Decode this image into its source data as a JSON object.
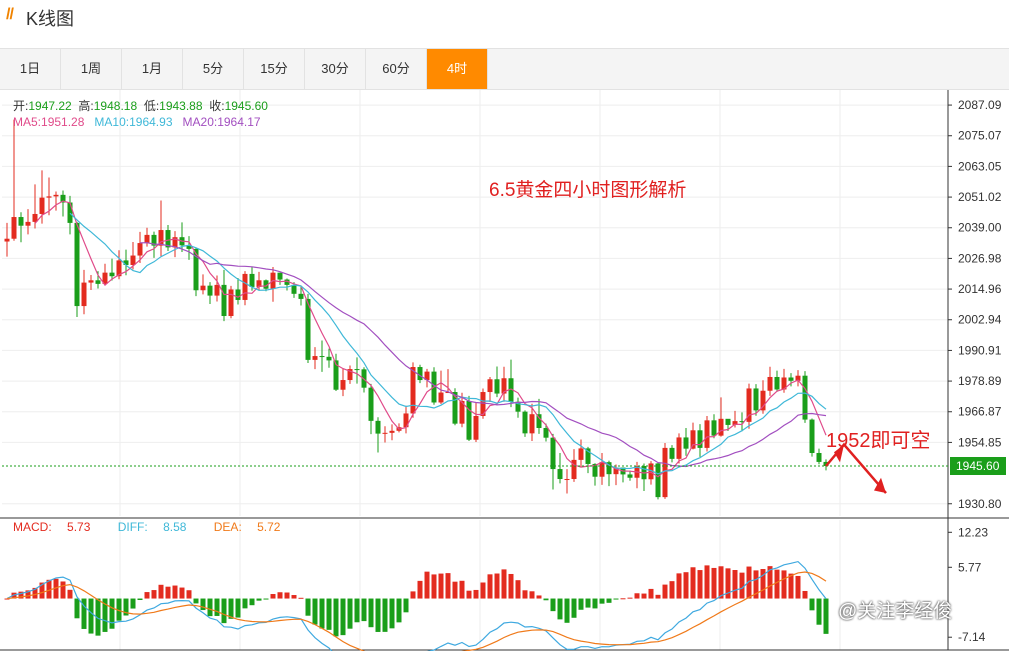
{
  "app": {
    "title": "K线图"
  },
  "tabs": [
    {
      "label": "1日",
      "active": false
    },
    {
      "label": "1周",
      "active": false
    },
    {
      "label": "1月",
      "active": false
    },
    {
      "label": "5分",
      "active": false
    },
    {
      "label": "15分",
      "active": false
    },
    {
      "label": "30分",
      "active": false
    },
    {
      "label": "60分",
      "active": false
    },
    {
      "label": "4时",
      "active": true
    }
  ],
  "ohlc": {
    "open_label": "开:",
    "open": "1947.22",
    "high_label": "高:",
    "high": "1948.18",
    "low_label": "低:",
    "low": "1943.88",
    "close_label": "收:",
    "close": "1945.60"
  },
  "ma": {
    "ma5_label": "MA5:",
    "ma5": "1951.28",
    "ma10_label": "MA10:",
    "ma10": "1964.93",
    "ma20_label": "MA20:",
    "ma20": "1964.17"
  },
  "macd_legend": {
    "macd_label": "MACD:",
    "macd": "5.73",
    "diff_label": "DIFF:",
    "diff": "8.58",
    "dea_label": "DEA:",
    "dea": "5.72"
  },
  "annotations": {
    "title": "6.5黄金四小时图形解析",
    "target": "1952即可空"
  },
  "watermark": "@关注李经俊",
  "colors": {
    "up": "#e32b1f",
    "down": "#1a9e1a",
    "ma5": "#e04b8a",
    "ma10": "#3fb8d8",
    "ma20": "#a24fc0",
    "diff": "#3fa9e0",
    "dea": "#f07a1a",
    "last_price_bg": "#1a9e1a",
    "accent": "#ff8a00"
  },
  "chart_data": {
    "type": "candlestick",
    "price_axis": {
      "ticks": [
        "2087.09",
        "2075.07",
        "2063.05",
        "2051.02",
        "2039.00",
        "2026.98",
        "2014.96",
        "2002.94",
        "1990.91",
        "1978.89",
        "1966.87",
        "1954.85",
        "1930.80"
      ],
      "last_price": "1945.60",
      "range": [
        1926.0,
        2093.0
      ]
    },
    "macd_axis": {
      "ticks": [
        "12.23",
        "5.77",
        "-7.14"
      ],
      "range": [
        -9.5,
        14.5
      ]
    },
    "candles": [
      [
        2033.6,
        2034.7,
        2027.7,
        2040.9
      ],
      [
        2034.7,
        2043.2,
        2033.9,
        2081.4
      ],
      [
        2043.2,
        2039.8,
        2033.3,
        2045.1
      ],
      [
        2039.8,
        2041.3,
        2036.4,
        2046.3
      ],
      [
        2041.3,
        2044.4,
        2038.7,
        2056.0
      ],
      [
        2044.4,
        2050.8,
        2040.6,
        2061.5
      ],
      [
        2050.8,
        2051.3,
        2043.9,
        2058.7
      ],
      [
        2051.3,
        2051.9,
        2045.7,
        2053.2
      ],
      [
        2051.9,
        2048.9,
        2043.4,
        2053.6
      ],
      [
        2048.9,
        2040.9,
        2036.4,
        2051.5
      ],
      [
        2040.9,
        2008.3,
        2004.0,
        2041.3
      ],
      [
        2008.3,
        2017.5,
        2005.1,
        2022.5
      ],
      [
        2017.5,
        2018.4,
        2014.6,
        2020.5
      ],
      [
        2018.4,
        2017.0,
        2015.2,
        2022.0
      ],
      [
        2017.0,
        2021.4,
        2016.3,
        2024.9
      ],
      [
        2021.4,
        2020.0,
        2018.3,
        2026.9
      ],
      [
        2020.0,
        2026.2,
        2018.8,
        2030.2
      ],
      [
        2026.2,
        2024.4,
        2020.4,
        2030.4
      ],
      [
        2024.4,
        2028.1,
        2022.7,
        2033.4
      ],
      [
        2028.1,
        2033.0,
        2025.2,
        2037.4
      ],
      [
        2033.0,
        2036.2,
        2031.6,
        2039.0
      ],
      [
        2036.2,
        2032.0,
        2027.2,
        2037.5
      ],
      [
        2032.0,
        2038.1,
        2027.8,
        2049.7
      ],
      [
        2038.1,
        2031.3,
        2029.9,
        2040.1
      ],
      [
        2031.3,
        2035.3,
        2027.5,
        2037.7
      ],
      [
        2035.3,
        2032.1,
        2029.5,
        2041.1
      ],
      [
        2032.1,
        2030.7,
        2026.4,
        2035.7
      ],
      [
        2030.7,
        2014.5,
        2012.2,
        2031.0
      ],
      [
        2014.5,
        2016.3,
        2012.9,
        2020.7
      ],
      [
        2016.3,
        2012.4,
        2009.1,
        2017.7
      ],
      [
        2012.4,
        2016.6,
        2010.1,
        2020.3
      ],
      [
        2016.6,
        2004.4,
        2002.4,
        2022.5
      ],
      [
        2004.4,
        2014.8,
        2003.5,
        2016.2
      ],
      [
        2014.8,
        2010.7,
        2008.9,
        2019.3
      ],
      [
        2010.7,
        2020.9,
        2008.6,
        2022.0
      ],
      [
        2020.9,
        2015.8,
        2014.3,
        2023.6
      ],
      [
        2015.8,
        2018.4,
        2014.3,
        2021.7
      ],
      [
        2018.4,
        2015.1,
        2014.1,
        2018.7
      ],
      [
        2015.1,
        2021.4,
        2010.0,
        2023.6
      ],
      [
        2021.4,
        2018.7,
        2016.6,
        2020.5
      ],
      [
        2018.7,
        2016.6,
        2014.4,
        2019.1
      ],
      [
        2016.6,
        2013.1,
        2011.5,
        2017.7
      ],
      [
        2013.1,
        2011.1,
        2008.5,
        2016.2
      ],
      [
        2011.1,
        1987.2,
        1986.0,
        2013.1
      ],
      [
        1987.2,
        1988.7,
        1983.6,
        1992.2
      ],
      [
        1988.7,
        1988.4,
        1982.5,
        1994.8
      ],
      [
        1988.4,
        1987.0,
        1984.1,
        1991.6
      ],
      [
        1987.0,
        1975.5,
        1975.0,
        1989.6
      ],
      [
        1975.5,
        1979.3,
        1973.0,
        1983.8
      ],
      [
        1979.3,
        1983.6,
        1977.8,
        1985.0
      ],
      [
        1983.6,
        1983.5,
        1977.9,
        1988.2
      ],
      [
        1983.5,
        1976.3,
        1974.4,
        1984.3
      ],
      [
        1976.3,
        1963.3,
        1958.1,
        1977.8
      ],
      [
        1963.3,
        1958.3,
        1950.9,
        1964.7
      ],
      [
        1958.3,
        1958.6,
        1954.8,
        1961.2
      ],
      [
        1958.6,
        1959.4,
        1955.7,
        1961.9
      ],
      [
        1959.4,
        1960.8,
        1958.8,
        1962.3
      ],
      [
        1960.8,
        1966.2,
        1958.4,
        1969.2
      ],
      [
        1966.2,
        1984.4,
        1964.5,
        1986.2
      ],
      [
        1984.4,
        1979.3,
        1978.1,
        1985.3
      ],
      [
        1979.3,
        1982.6,
        1976.4,
        1983.7
      ],
      [
        1982.6,
        1970.5,
        1969.6,
        1984.3
      ],
      [
        1970.5,
        1974.4,
        1969.9,
        1983.0
      ],
      [
        1974.4,
        1974.6,
        1974.2,
        1983.6
      ],
      [
        1974.6,
        1962.2,
        1961.6,
        1976.1
      ],
      [
        1962.2,
        1971.1,
        1960.8,
        1974.3
      ],
      [
        1971.1,
        1955.9,
        1955.4,
        1973.1
      ],
      [
        1955.9,
        1965.2,
        1955.0,
        1970.7
      ],
      [
        1965.2,
        1974.6,
        1964.1,
        1976.0
      ],
      [
        1974.6,
        1979.6,
        1970.7,
        1980.5
      ],
      [
        1979.6,
        1974.0,
        1972.6,
        1984.6
      ],
      [
        1974.0,
        1980.0,
        1970.8,
        1984.5
      ],
      [
        1980.0,
        1970.8,
        1968.7,
        1987.3
      ],
      [
        1970.8,
        1966.9,
        1964.5,
        1972.4
      ],
      [
        1966.9,
        1958.4,
        1957.0,
        1967.4
      ],
      [
        1958.4,
        1965.9,
        1955.4,
        1970.0
      ],
      [
        1965.9,
        1960.5,
        1958.2,
        1971.9
      ],
      [
        1960.5,
        1956.7,
        1955.2,
        1962.2
      ],
      [
        1956.7,
        1944.4,
        1936.4,
        1958.2
      ],
      [
        1944.4,
        1940.5,
        1938.8,
        1950.7
      ],
      [
        1940.5,
        1940.5,
        1934.8,
        1944.4
      ],
      [
        1940.5,
        1948.0,
        1939.4,
        1952.2
      ],
      [
        1948.0,
        1952.5,
        1945.2,
        1956.0
      ],
      [
        1952.5,
        1946.4,
        1942.8,
        1953.1
      ],
      [
        1946.4,
        1941.4,
        1937.9,
        1946.7
      ],
      [
        1941.4,
        1947.1,
        1938.2,
        1950.7
      ],
      [
        1947.1,
        1942.4,
        1937.7,
        1947.7
      ],
      [
        1942.4,
        1945.0,
        1938.1,
        1946.2
      ],
      [
        1945.0,
        1942.3,
        1939.2,
        1944.7
      ],
      [
        1942.3,
        1941.0,
        1939.8,
        1943.8
      ],
      [
        1941.0,
        1945.6,
        1936.9,
        1947.2
      ],
      [
        1945.6,
        1940.4,
        1935.8,
        1946.6
      ],
      [
        1940.4,
        1946.6,
        1938.3,
        1947.5
      ],
      [
        1946.6,
        1933.4,
        1932.5,
        1946.8
      ],
      [
        1933.4,
        1952.7,
        1932.7,
        1954.6
      ],
      [
        1952.7,
        1948.4,
        1947.0,
        1953.8
      ],
      [
        1948.4,
        1956.8,
        1946.6,
        1958.4
      ],
      [
        1956.8,
        1952.4,
        1949.6,
        1960.5
      ],
      [
        1952.4,
        1959.6,
        1952.1,
        1962.6
      ],
      [
        1959.6,
        1952.7,
        1949.2,
        1962.0
      ],
      [
        1952.7,
        1963.5,
        1951.3,
        1965.2
      ],
      [
        1963.5,
        1957.5,
        1956.5,
        1965.9
      ],
      [
        1957.5,
        1964.1,
        1957.1,
        1972.5
      ],
      [
        1964.1,
        1961.7,
        1959.3,
        1964.0
      ],
      [
        1961.7,
        1963.2,
        1960.7,
        1967.2
      ],
      [
        1963.2,
        1962.9,
        1959.2,
        1966.6
      ],
      [
        1962.9,
        1976.0,
        1960.2,
        1977.9
      ],
      [
        1976.0,
        1967.4,
        1965.3,
        1977.7
      ],
      [
        1967.4,
        1975.1,
        1966.1,
        1979.2
      ],
      [
        1975.1,
        1980.5,
        1973.1,
        1984.5
      ],
      [
        1980.5,
        1975.6,
        1974.7,
        1983.0
      ],
      [
        1975.6,
        1980.3,
        1974.3,
        1983.7
      ],
      [
        1980.3,
        1979.0,
        1976.8,
        1982.0
      ],
      [
        1979.0,
        1981.0,
        1976.8,
        1983.2
      ],
      [
        1981.0,
        1963.8,
        1962.5,
        1982.8
      ],
      [
        1963.8,
        1950.7,
        1949.3,
        1964.2
      ],
      [
        1950.7,
        1947.2,
        1946.3,
        1952.4
      ],
      [
        1947.2,
        1945.6,
        1943.9,
        1948.2
      ]
    ]
  }
}
